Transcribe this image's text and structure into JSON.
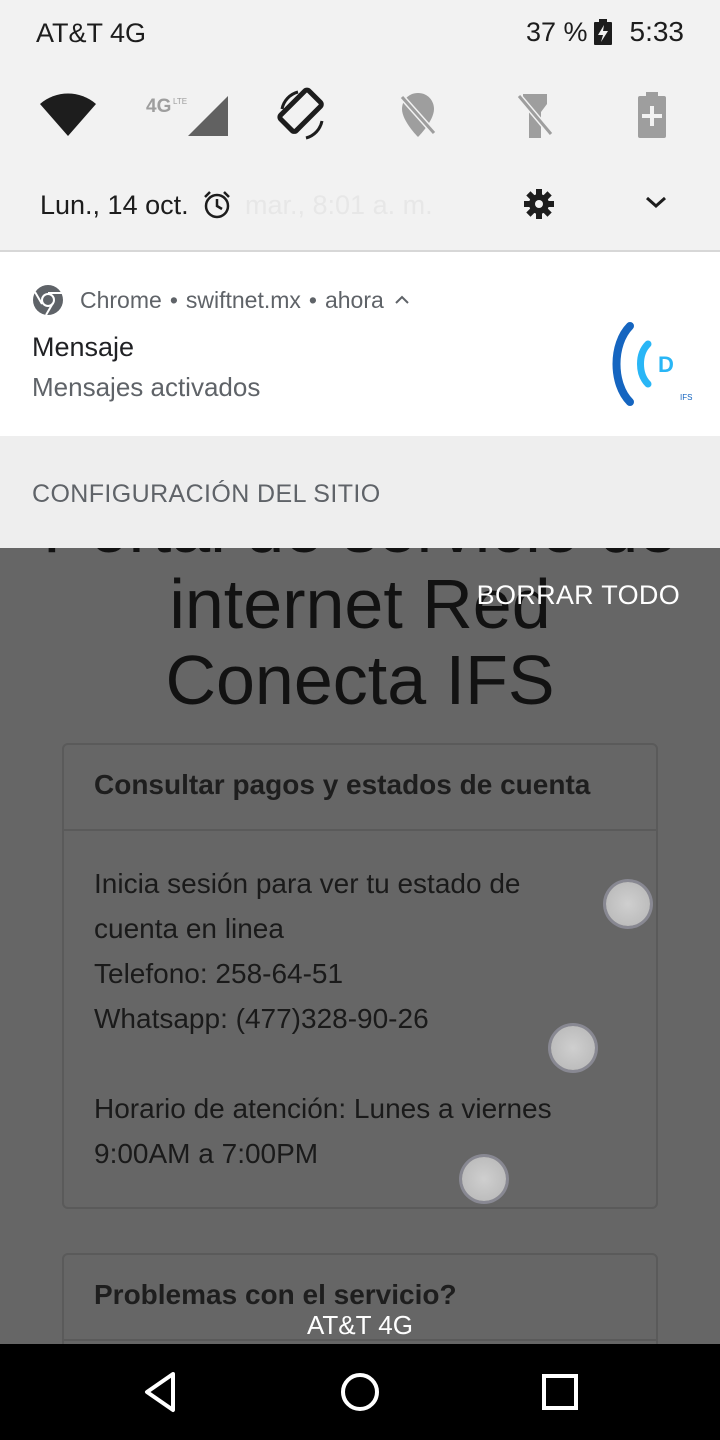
{
  "status_bar": {
    "carrier": "AT&T 4G",
    "battery_percent": "37 %",
    "time": "5:33"
  },
  "quick_settings": {
    "tiles": [
      "wifi-icon",
      "cellular-4g-icon",
      "auto-rotate-icon",
      "location-off-icon",
      "flashlight-off-icon",
      "battery-saver-icon"
    ],
    "network_badge": "4G"
  },
  "date_row": {
    "date": "Lun., 14 oct.",
    "alarm": "mar., 8:01 a. m."
  },
  "notification": {
    "app": "Chrome",
    "domain": "swiftnet.mx",
    "time": "ahora",
    "separator": "•",
    "title": "Mensaje",
    "text": "Mensajes activados",
    "logo_letter": "D",
    "logo_caption": "IFS"
  },
  "site_settings_label": "CONFIGURACIÓN DEL SITIO",
  "clear_all_label": "BORRAR TODO",
  "webpage": {
    "title_lines": [
      "Portal de servicio de",
      "internet Red",
      "Conecta IFS"
    ],
    "card1": {
      "header": "Consultar pagos y estados de cuenta",
      "lines": [
        "Inicia sesión para ver tu estado de",
        "cuenta en linea",
        "Telefono: 258-64-51",
        "Whatsapp: (477)328-90-26",
        "",
        "Horario de atención: Lunes a viernes",
        "9:00AM a 7:00PM"
      ]
    },
    "card2": {
      "header": "Problemas con el servicio?"
    }
  },
  "bottom_carrier": "AT&T 4G",
  "nav": [
    "back-icon",
    "home-icon",
    "recents-icon"
  ],
  "colors": {
    "accent_blue": "#1565c0",
    "accent_light_blue": "#29b6f6",
    "shade_bg": "#f2f2f2",
    "scrim": "#666666"
  }
}
